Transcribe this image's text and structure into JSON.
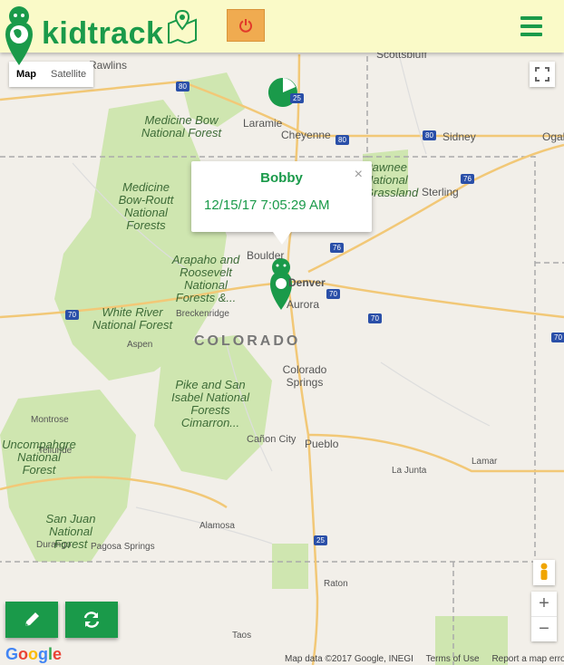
{
  "header": {
    "brand": "kidtrack",
    "menu_icon": "hamburger-icon",
    "map_icon": "map-pin-icon",
    "power_icon": "power-icon"
  },
  "map_controls": {
    "type_map": "Map",
    "type_satellite": "Satellite",
    "zoom_in": "+",
    "zoom_out": "−"
  },
  "info_window": {
    "name": "Bobby",
    "timestamp": "12/15/17 7:05:29 AM",
    "close": "×"
  },
  "map": {
    "state_label": "COLORADO",
    "cities": [
      {
        "name": "Rawlins"
      },
      {
        "name": "Laramie"
      },
      {
        "name": "Cheyenne"
      },
      {
        "name": "Scottsbluff"
      },
      {
        "name": "Sidney"
      },
      {
        "name": "Ogall"
      },
      {
        "name": "Sterling"
      },
      {
        "name": "Boulder"
      },
      {
        "name": "Denver"
      },
      {
        "name": "Aurora"
      },
      {
        "name": "Breckenridge"
      },
      {
        "name": "Aspen"
      },
      {
        "name": "Colorado Springs"
      },
      {
        "name": "Montrose"
      },
      {
        "name": "Telluride"
      },
      {
        "name": "Cañon City"
      },
      {
        "name": "Pueblo"
      },
      {
        "name": "La Junta"
      },
      {
        "name": "Lamar"
      },
      {
        "name": "Alamosa"
      },
      {
        "name": "Durango"
      },
      {
        "name": "Pagosa Springs"
      },
      {
        "name": "Raton"
      },
      {
        "name": "Taos"
      }
    ],
    "parks": [
      {
        "name": "Medicine Bow National Forest"
      },
      {
        "name": "Medicine Bow-Routt National Forests"
      },
      {
        "name": "Arapaho and Roosevelt National Forests &..."
      },
      {
        "name": "White River National Forest"
      },
      {
        "name": "Pike and San Isabel National Forests Cimarron..."
      },
      {
        "name": "Uncompahgre National Forest"
      },
      {
        "name": "San Juan National Forest"
      },
      {
        "name": "Pawnee National Grassland"
      }
    ],
    "highways": [
      "80",
      "25",
      "80",
      "80",
      "76",
      "76",
      "70",
      "70",
      "70",
      "25",
      "70"
    ]
  },
  "footer": {
    "google": "Google",
    "map_data": "Map data ©2017 Google, INEGI",
    "terms": "Terms of Use",
    "report": "Report a map error"
  },
  "colors": {
    "brand_green": "#1a9a4a",
    "header_bg": "#fafac8",
    "power_orange": "#f0ab50"
  }
}
